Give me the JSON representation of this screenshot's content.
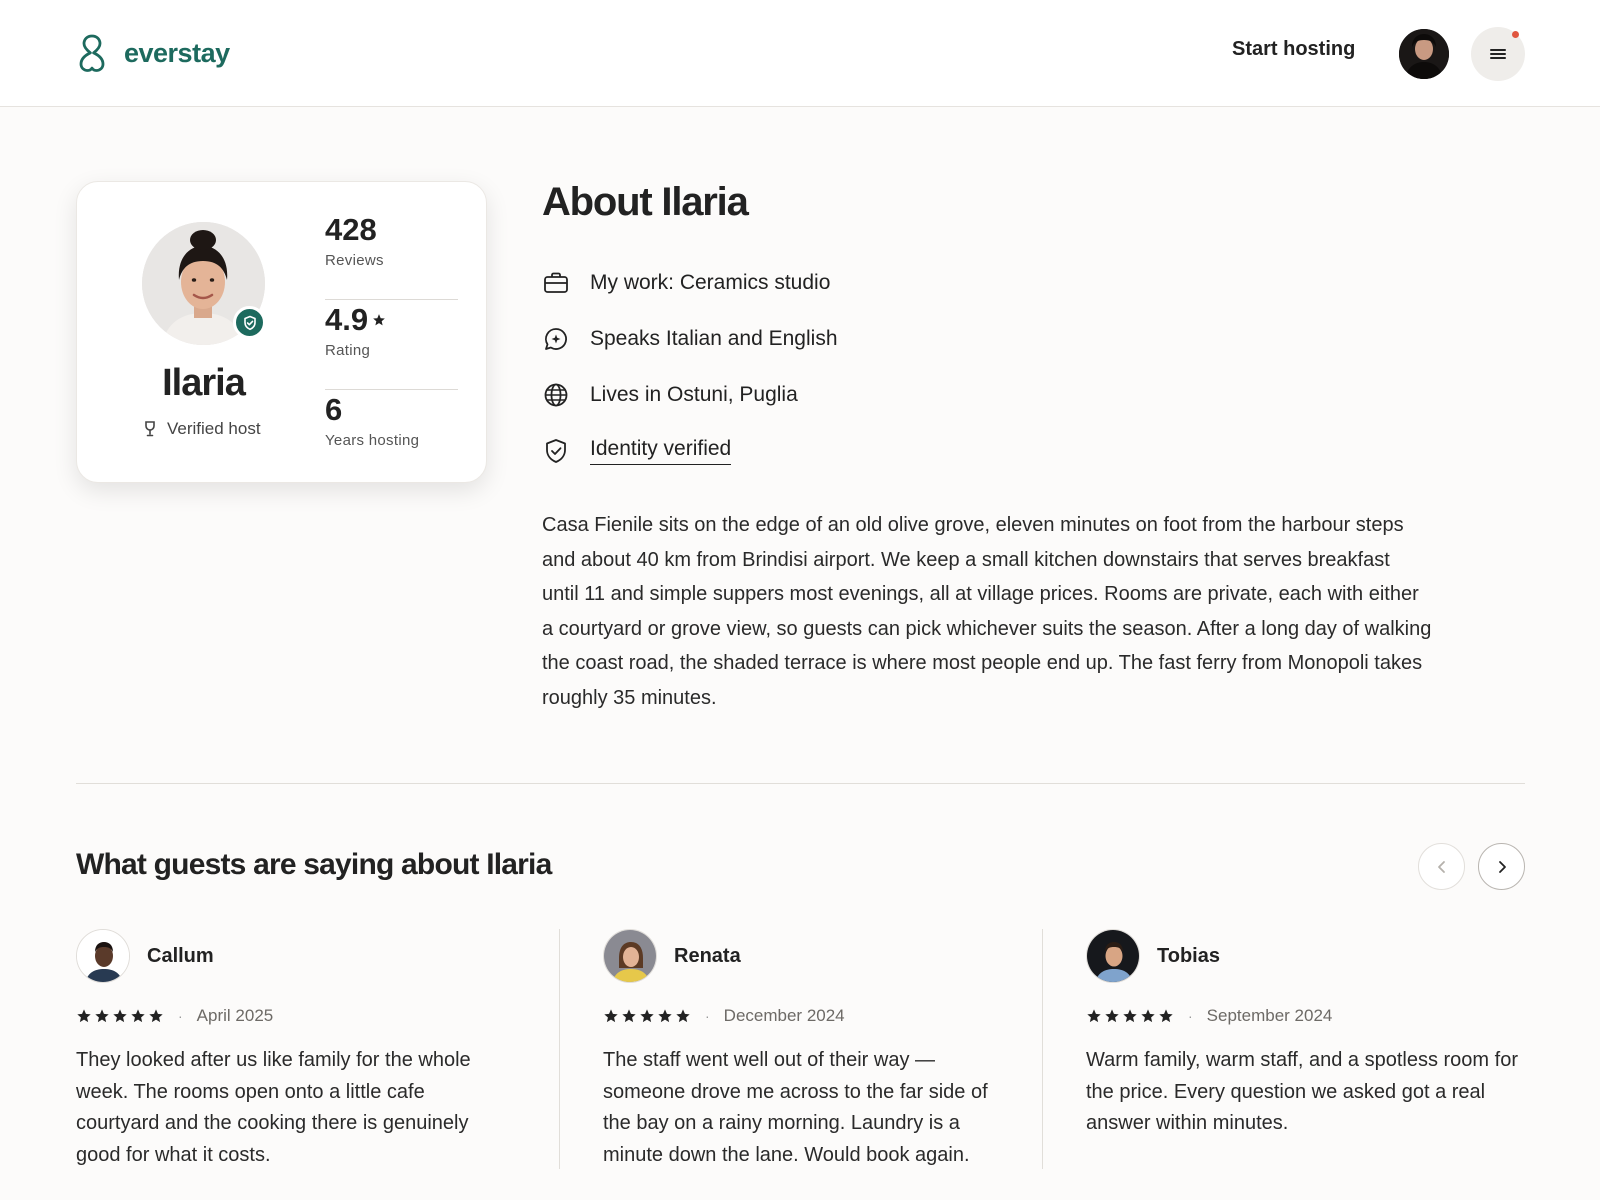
{
  "header": {
    "brand": "everstay",
    "start_hosting": "Start hosting"
  },
  "host_card": {
    "name": "Ilaria",
    "verified_label": "Verified host",
    "stats": [
      {
        "value": "428",
        "label": "Reviews"
      },
      {
        "value": "4.9",
        "label": "Rating"
      },
      {
        "value": "6",
        "label": "Years hosting"
      }
    ]
  },
  "about": {
    "title": "About Ilaria",
    "facts": [
      {
        "icon": "briefcase-icon",
        "text": "My work: Ceramics studio"
      },
      {
        "icon": "speech-bubble-icon",
        "text": "Speaks Italian and English"
      },
      {
        "icon": "globe-icon",
        "text": "Lives in Ostuni, Puglia"
      },
      {
        "icon": "shield-check-icon",
        "text": "Identity verified"
      }
    ],
    "bio": "Casa Fienile sits on the edge of an old olive grove, eleven minutes on foot from the harbour steps and about 40 km from Brindisi airport. We keep a small kitchen downstairs that serves breakfast until 11 and simple suppers most evenings, all at village prices. Rooms are private, each with either a courtyard or grove view, so guests can pick whichever suits the season. After a long day of walking the coast road, the shaded terrace is where most people end up. The fast ferry from Monopoli takes roughly 35 minutes."
  },
  "reviews": {
    "title": "What guests are saying about Ilaria",
    "items": [
      {
        "name": "Callum",
        "stars": 5,
        "date": "April 2025",
        "text": "They looked after us like family for the whole week. The rooms open onto a little cafe courtyard and the cooking there is genuinely good for what it costs."
      },
      {
        "name": "Renata",
        "stars": 5,
        "date": "December 2024",
        "text": "The staff went well out of their way — someone drove me across to the far side of the bay on a rainy morning. Laundry is a minute down the lane. Would book again."
      },
      {
        "name": "Tobias",
        "stars": 5,
        "date": "September 2024",
        "text": "Warm family, warm staff, and a spotless room for the price. Every question we asked got a real answer within minutes."
      }
    ]
  },
  "colors": {
    "brand": "#1d6a5e",
    "notification": "#e0563f"
  }
}
